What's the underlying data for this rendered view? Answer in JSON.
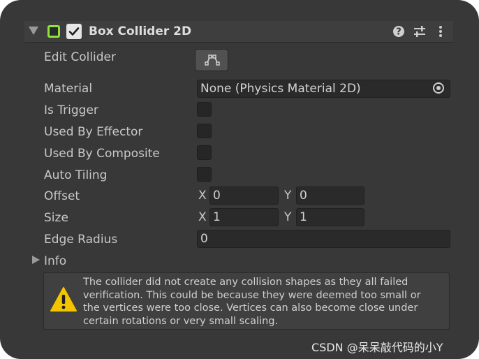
{
  "component": {
    "title": "Box Collider 2D",
    "enabled": true
  },
  "properties": {
    "edit_collider_label": "Edit Collider",
    "material_label": "Material",
    "material_value": "None (Physics Material 2D)",
    "is_trigger_label": "Is Trigger",
    "is_trigger": false,
    "used_by_effector_label": "Used By Effector",
    "used_by_effector": false,
    "used_by_composite_label": "Used By Composite",
    "used_by_composite": false,
    "auto_tiling_label": "Auto Tiling",
    "auto_tiling": false,
    "offset_label": "Offset",
    "offset": {
      "x_label": "X",
      "x": "0",
      "y_label": "Y",
      "y": "0"
    },
    "size_label": "Size",
    "size": {
      "x_label": "X",
      "x": "1",
      "y_label": "Y",
      "y": "1"
    },
    "edge_radius_label": "Edge Radius",
    "edge_radius": "0"
  },
  "info": {
    "label": "Info",
    "expanded": false
  },
  "warning": {
    "lines": [
      "The collider did not create any collision shapes as they all failed",
      "verification.  This could be because they were deemed too small or",
      "the vertices were too close.  Vertices can also become close under",
      "certain rotations or very small scaling."
    ]
  },
  "watermark": "CSDN @呆呆敲代码的小Y",
  "colors": {
    "panel_bg": "#383838",
    "header_bg": "#3e3e3e",
    "collider_icon": "#8ee23b",
    "warning_yellow": "#f5c400"
  },
  "icons": {
    "foldout": "triangle-down",
    "component": "box-collider-2d-icon",
    "help": "help-icon",
    "presets": "sliders-icon",
    "menu": "kebab-menu-icon",
    "edit_collider": "polygon-edit-icon",
    "object_picker": "target-circle-icon",
    "warning": "warning-triangle-icon"
  }
}
